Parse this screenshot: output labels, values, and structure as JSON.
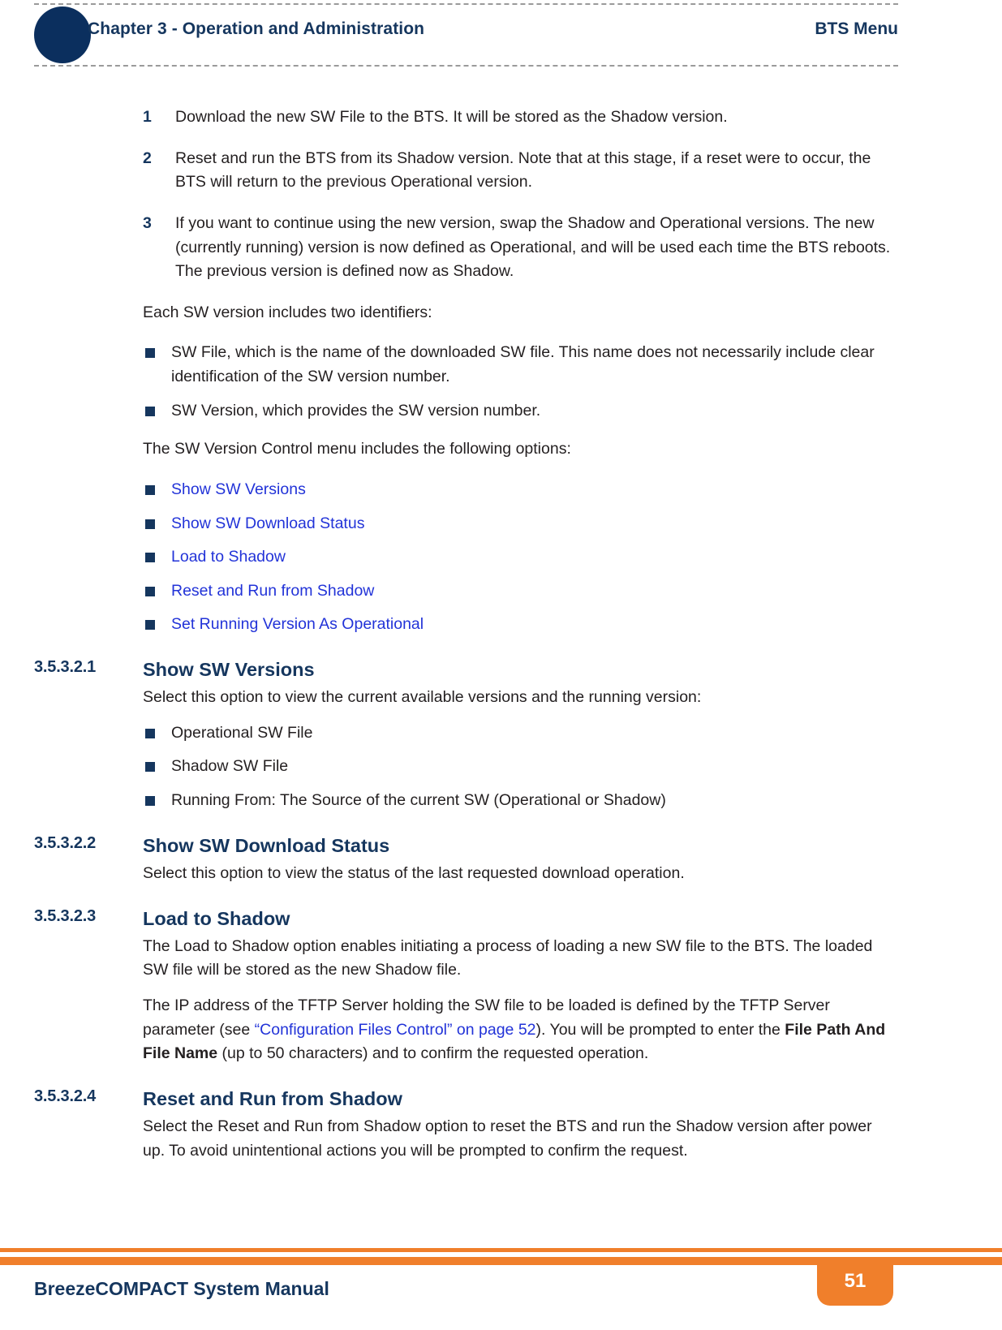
{
  "header": {
    "chapter": "Chapter 3 - Operation and Administration",
    "topic": "BTS Menu"
  },
  "content": {
    "numbered_steps": [
      {
        "number": "1",
        "text": "Download the new SW File to the BTS. It will be stored as the Shadow version."
      },
      {
        "number": "2",
        "text": "Reset and run the BTS from its Shadow version. Note that at this stage, if a reset were to occur, the BTS will return to the previous Operational version."
      },
      {
        "number": "3",
        "text": "If you want to continue using the new version, swap the Shadow and Operational versions. The new (currently running) version is now defined as Operational, and will be used each time the BTS reboots. The previous version is defined now as Shadow."
      }
    ],
    "identifiers_intro": "Each SW version includes two identifiers:",
    "identifiers": [
      "SW File, which is the name of the downloaded SW file. This name does not necessarily include clear identification of the SW version number.",
      "SW Version, which provides the SW version number."
    ],
    "options_intro": "The SW Version Control menu includes the following options:",
    "options": [
      "Show SW Versions",
      "Show SW Download Status",
      "Load to Shadow",
      "Reset and Run from Shadow",
      "Set Running Version As Operational"
    ]
  },
  "sections": [
    {
      "number": "3.5.3.2.1",
      "title": "Show SW Versions",
      "intro": "Select this option to view the current available versions and the running version:",
      "bullets": [
        "Operational SW File",
        "Shadow SW File",
        "Running From: The Source of the current SW (Operational or Shadow)"
      ]
    },
    {
      "number": "3.5.3.2.2",
      "title": "Show SW Download Status",
      "intro": "Select this option to view the status of the last requested download operation."
    },
    {
      "number": "3.5.3.2.3",
      "title": "Load to Shadow",
      "para1": "The Load to Shadow option enables initiating a process of loading a new SW file to the BTS. The loaded SW file will be stored as the new Shadow file.",
      "para2_a": "The IP address of the TFTP Server holding the SW file to be loaded is defined by the TFTP Server parameter (see ",
      "para2_link": "“Configuration Files Control” on page 52",
      "para2_b": "). You will be prompted to enter the ",
      "para2_bold": "File Path And File Name",
      "para2_c": " (up to 50 characters) and to confirm the requested operation."
    },
    {
      "number": "3.5.3.2.4",
      "title": "Reset and Run from Shadow",
      "intro": "Select the Reset and Run from Shadow option to reset the BTS and run the Shadow version after power up. To avoid unintentional actions you will be prompted to confirm the request."
    }
  ],
  "footer": {
    "manual_title": "BreezeCOMPACT System Manual",
    "page_number": "51"
  },
  "colors": {
    "navy": "#15365e",
    "link_blue": "#2233d8",
    "orange": "#f07f2b",
    "circle_navy": "#0b2f5e"
  }
}
